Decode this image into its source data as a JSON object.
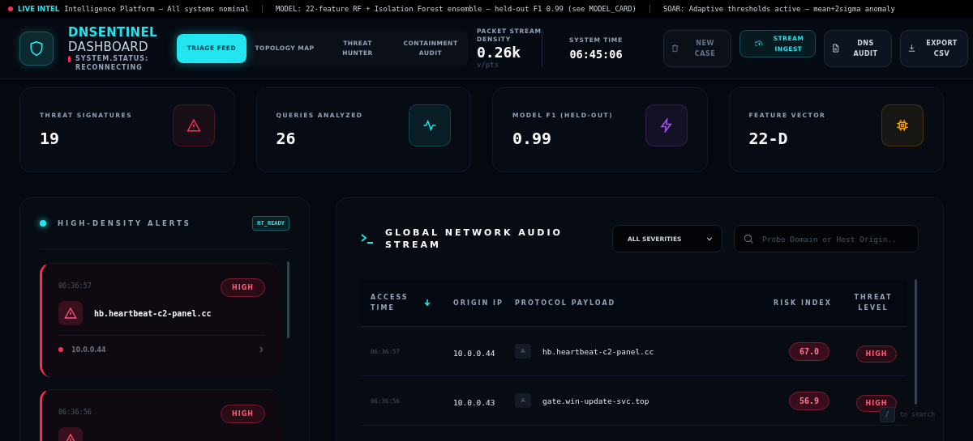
{
  "ticker": {
    "label": "LIVE INTEL",
    "messages": [
      "Intelligence Platform — All systems nominal",
      "MODEL: 22-feature RF + Isolation Forest ensemble — held-out F1 0.99 (see MODEL_CARD)",
      "SOAR: Adaptive thresholds active — mean+2sigma anomaly"
    ]
  },
  "brand": {
    "title": "DNSENTINEL",
    "subtitle": "DASHBOARD",
    "status": "SYSTEM.STATUS: RECONNECTING"
  },
  "nav": [
    {
      "label": "TRIAGE FEED",
      "selected": true
    },
    {
      "label": "TOPOLOGY MAP",
      "selected": false
    },
    {
      "label": "THREAT HUNTER",
      "selected": false
    },
    {
      "label": "CONTAINMENT AUDIT",
      "selected": false
    }
  ],
  "density": {
    "label": "PACKET STREAM DENSITY",
    "value": "0.26k",
    "unit": "v/pts"
  },
  "system_time": {
    "label": "SYSTEM TIME",
    "value": "06:45:06"
  },
  "actions": [
    {
      "label": "NEW CASE",
      "disabled": true,
      "selected": false
    },
    {
      "label": "STREAM INGEST",
      "disabled": false,
      "selected": true
    },
    {
      "label": "DNS AUDIT",
      "disabled": false,
      "selected": false
    },
    {
      "label": "EXPORT CSV",
      "disabled": false,
      "selected": false
    }
  ],
  "stats": [
    {
      "label": "THREAT SIGNATURES",
      "value": "19",
      "color": "#ff2d55"
    },
    {
      "label": "QUERIES ANALYZED",
      "value": "26",
      "color": "#22e5f0"
    },
    {
      "label": "MODEL F1 (HELD-OUT)",
      "value": "0.99",
      "color": "#a855f7"
    },
    {
      "label": "FEATURE VECTOR",
      "value": "22-D",
      "color": "#f59e0b"
    }
  ],
  "alerts": {
    "title": "HIGH-DENSITY ALERTS",
    "badge": "RT_READY",
    "items": [
      {
        "time": "06:36:57",
        "level": "HIGH",
        "domain": "hb.heartbeat-c2-panel.cc",
        "ip": "10.0.0.44"
      },
      {
        "time": "06:36:56",
        "level": "HIGH"
      }
    ]
  },
  "stream": {
    "title": "GLOBAL NETWORK AUDIO STREAM",
    "filter": "ALL SEVERITIES",
    "search_placeholder": "Probe Domain or Host Origin..",
    "columns": [
      "ACCESS TIME",
      "ORIGIN IP",
      "PROTOCOL PAYLOAD",
      "RISK INDEX",
      "THREAT LEVEL"
    ],
    "rows": [
      {
        "time": "06:36:57",
        "ip": "10.0.0.44",
        "type": "A",
        "domain": "hb.heartbeat-c2-panel.cc",
        "risk": "67.0",
        "level": "HIGH"
      },
      {
        "time": "06:36:56",
        "ip": "10.0.0.43",
        "type": "A",
        "domain": "gate.win-update-svc.top",
        "risk": "56.9",
        "level": "HIGH"
      }
    ],
    "search_hint": {
      "key": "/",
      "text": "to search"
    }
  }
}
